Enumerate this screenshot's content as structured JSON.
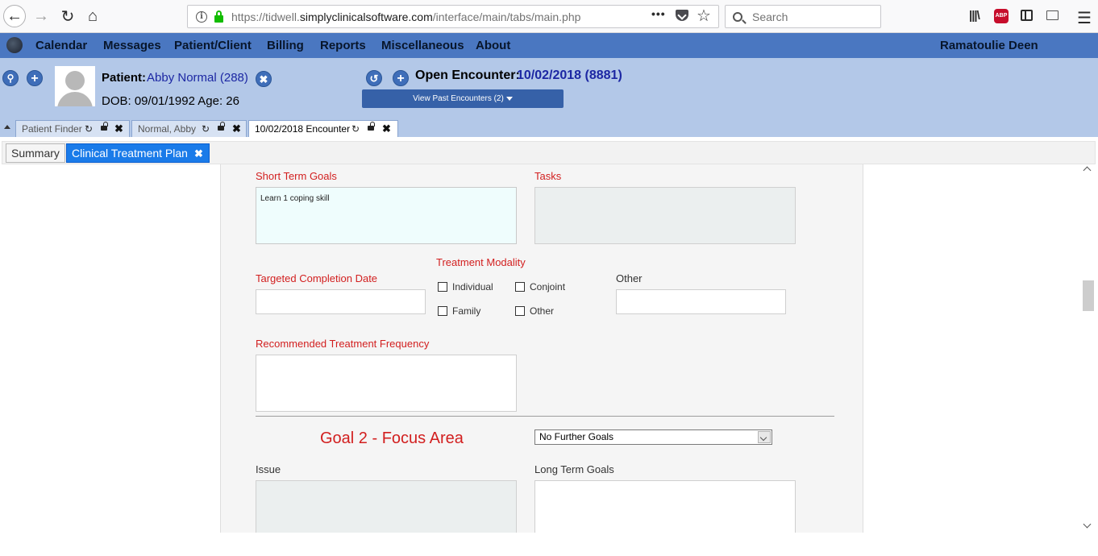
{
  "browser": {
    "url_prefix": "https://tidwell.",
    "url_domain": "simplyclinicalsoftware.com",
    "url_path": "/interface/main/tabs/main.php",
    "search_placeholder": "Search",
    "url_dots": "•••",
    "abp_label": "ABP"
  },
  "menubar": {
    "items": [
      "Calendar",
      "Messages",
      "Patient/Client",
      "Billing",
      "Reports",
      "Miscellaneous",
      "About"
    ],
    "user": "Ramatoulie Deen"
  },
  "patient": {
    "label": "Patient:",
    "name": "Abby Normal (288)",
    "dob": "DOB: 09/01/1992 Age: 26"
  },
  "encounter": {
    "label": "Open Encounter:",
    "value": "10/02/2018 (8881)",
    "past_button": "View Past Encounters  (2)"
  },
  "top_tabs": [
    "Patient Finder",
    "Normal, Abby",
    "10/02/2018 Encounter"
  ],
  "sub_tabs": {
    "summary": "Summary",
    "active": "Clinical Treatment Plan"
  },
  "form": {
    "short_term_goals_label": "Short Term Goals",
    "short_term_goals_value": "Learn 1 coping skill",
    "tasks_label": "Tasks",
    "treatment_modality_label": "Treatment Modality",
    "targeted_completion_label": "Targeted Completion Date",
    "modalities": [
      "Individual",
      "Conjoint",
      "Family",
      "Other"
    ],
    "other_label": "Other",
    "frequency_label": "Recommended Treatment Frequency",
    "goal2_title": "Goal 2 - Focus Area",
    "goal_select_value": "No Further Goals",
    "issue_label": "Issue",
    "long_term_goals_label": "Long Term Goals"
  }
}
